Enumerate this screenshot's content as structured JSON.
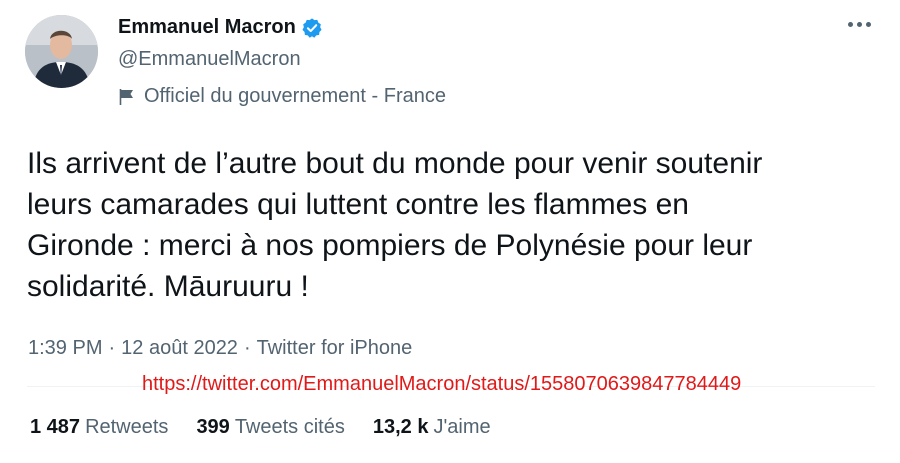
{
  "author": {
    "name": "Emmanuel Macron",
    "handle": "@EmmanuelMacron",
    "affiliation": "Officiel du gouvernement - France"
  },
  "tweet": {
    "text": "Ils arrivent de l’autre bout du monde pour venir soutenir leurs camarades qui luttent contre les flammes en Gironde : merci à nos pompiers de Polynésie pour leur solidarité. Māuruuru !",
    "time": "1:39 PM",
    "date": "12 août 2022",
    "source": "Twitter for iPhone",
    "separator": "·",
    "url": "https://twitter.com/EmmanuelMacron/status/1558070639847784449"
  },
  "stats": {
    "retweets_count": "1 487",
    "retweets_label": "Retweets",
    "quotes_count": "399",
    "quotes_label": "Tweets cités",
    "likes_count": "13,2 k",
    "likes_label": "J'aime"
  },
  "icons": {
    "verified": "verified-badge-icon",
    "affiliation": "flag-icon",
    "more": "more-options-icon"
  },
  "colors": {
    "verified_blue": "#1d9bf0",
    "secondary_text": "#536471",
    "url_red": "#e01919"
  }
}
